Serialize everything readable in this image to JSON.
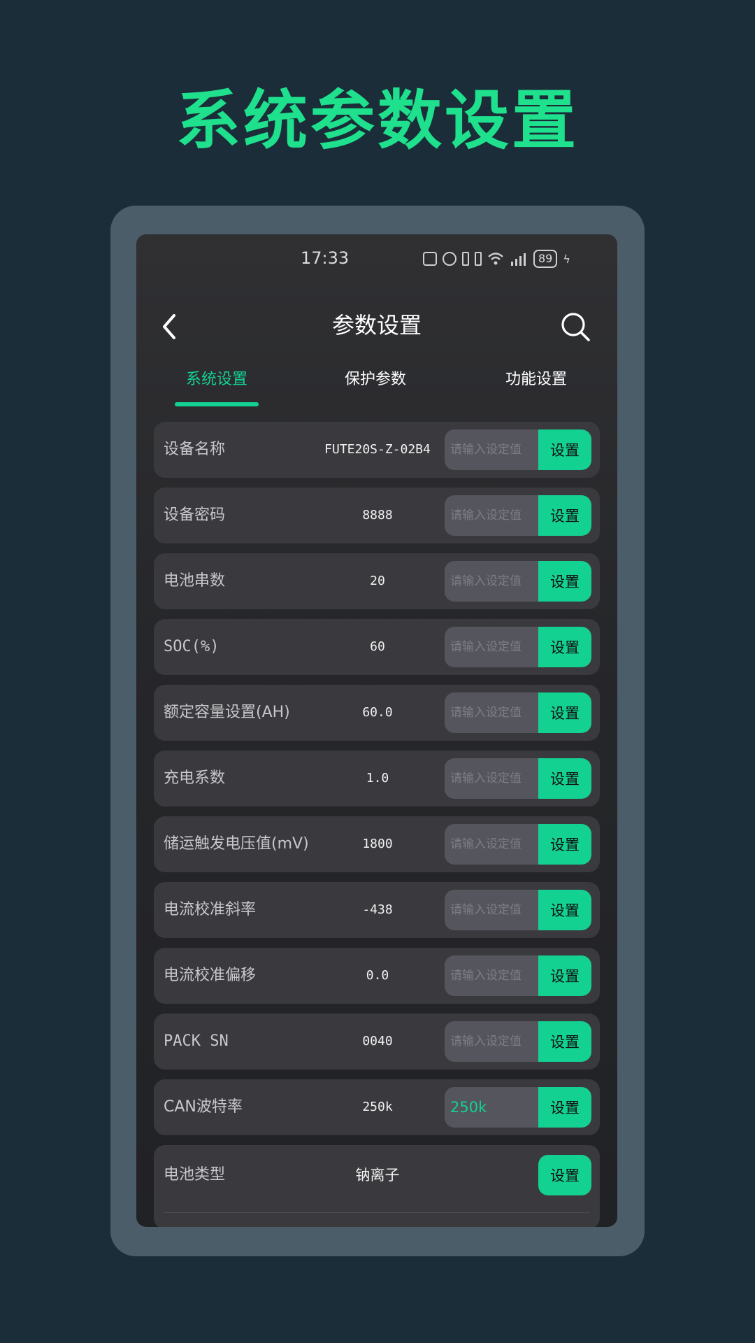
{
  "colors": {
    "page_background": "#1b2d39",
    "headline": "#1fe08c",
    "frame": "#4a5d69",
    "accent": "#13d191",
    "tab_inactive": "#ffffff"
  },
  "headline": "系统参数设置",
  "status_bar": {
    "time": "17:33",
    "battery": "89",
    "icons": [
      "nfc-icon",
      "alarm-icon",
      "bluetooth-icon",
      "vibrate-icon",
      "wifi-icon",
      "signal-5g-icon",
      "battery-icon",
      "charging-icon"
    ]
  },
  "app_bar": {
    "title": "参数设置",
    "back_icon": "chevron-left-icon",
    "search_icon": "search-icon"
  },
  "tabs": [
    {
      "label": "系统设置",
      "active": true
    },
    {
      "label": "保护参数",
      "active": false
    },
    {
      "label": "功能设置",
      "active": false
    }
  ],
  "input_placeholder": "请输入设定值",
  "set_button_label": "设置",
  "rows": [
    {
      "label": "设备名称",
      "value": "FUTE20S-Z-02B4"
    },
    {
      "label": "设备密码",
      "value": "8888"
    },
    {
      "label": "电池串数",
      "value": "20"
    },
    {
      "label": "SOC(%)",
      "value": "60"
    },
    {
      "label": "额定容量设置(AH)",
      "value": "60.0"
    },
    {
      "label": "充电系数",
      "value": "1.0"
    },
    {
      "label": "储运触发电压值(mV)",
      "value": "1800"
    },
    {
      "label": "电流校准斜率",
      "value": "-438"
    },
    {
      "label": "电流校准偏移",
      "value": "0.0"
    },
    {
      "label": "PACK SN",
      "value": "0040"
    },
    {
      "label": "CAN波特率",
      "value": "250k",
      "input_value": "250k"
    }
  ],
  "battery_type_row": {
    "label": "电池类型",
    "value": "钠离子"
  }
}
